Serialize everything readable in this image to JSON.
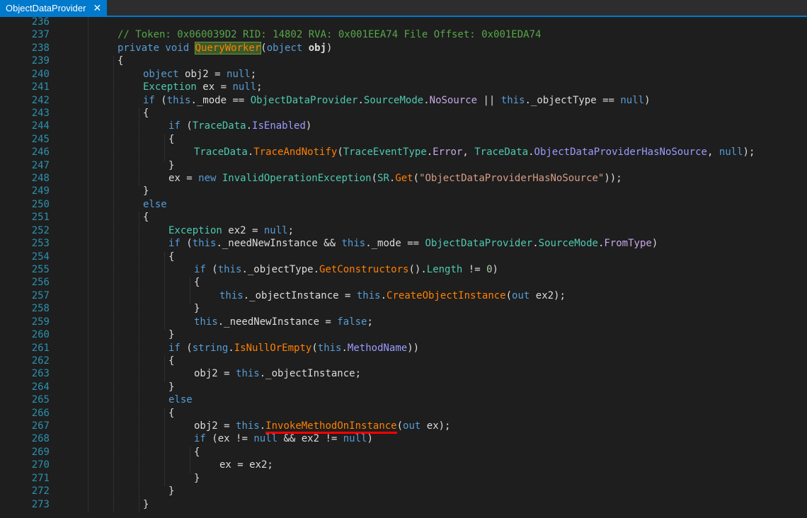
{
  "tab": {
    "title": "ObjectDataProvider",
    "close": "✕"
  },
  "lines": [
    {
      "n": "236",
      "segs": []
    },
    {
      "n": "237",
      "segs": [
        {
          "t": "// Token: 0x060039D2 RID: 14802 RVA: 0x001EEA74 File Offset: 0x001EDA74",
          "c": "c"
        }
      ],
      "ind": 1
    },
    {
      "n": "238",
      "segs": [
        {
          "t": "private void ",
          "c": "k"
        },
        {
          "t": "QueryWorker",
          "c": "hl"
        },
        {
          "t": "(",
          "c": ""
        },
        {
          "t": "object ",
          "c": "k"
        },
        {
          "t": "obj",
          "c": "bold"
        },
        {
          "t": ")",
          "c": ""
        }
      ],
      "ind": 1
    },
    {
      "n": "239",
      "segs": [
        {
          "t": "{",
          "c": ""
        }
      ],
      "ind": 1
    },
    {
      "n": "240",
      "segs": [
        {
          "t": "object ",
          "c": "k"
        },
        {
          "t": "obj2 = ",
          "c": ""
        },
        {
          "t": "null",
          "c": "k"
        },
        {
          "t": ";",
          "c": ""
        }
      ],
      "ind": 2
    },
    {
      "n": "241",
      "segs": [
        {
          "t": "Exception ",
          "c": "t"
        },
        {
          "t": "ex = ",
          "c": ""
        },
        {
          "t": "null",
          "c": "k"
        },
        {
          "t": ";",
          "c": ""
        }
      ],
      "ind": 2
    },
    {
      "n": "242",
      "segs": [
        {
          "t": "if ",
          "c": "k"
        },
        {
          "t": "(",
          "c": ""
        },
        {
          "t": "this",
          "c": "k"
        },
        {
          "t": "._mode == ",
          "c": ""
        },
        {
          "t": "ObjectDataProvider",
          "c": "t"
        },
        {
          "t": ".",
          "c": ""
        },
        {
          "t": "SourceMode",
          "c": "t"
        },
        {
          "t": ".",
          "c": ""
        },
        {
          "t": "NoSource",
          "c": "p"
        },
        {
          "t": " || ",
          "c": ""
        },
        {
          "t": "this",
          "c": "k"
        },
        {
          "t": "._objectType == ",
          "c": ""
        },
        {
          "t": "null",
          "c": "k"
        },
        {
          "t": ")",
          "c": ""
        }
      ],
      "ind": 2
    },
    {
      "n": "243",
      "segs": [
        {
          "t": "{",
          "c": ""
        }
      ],
      "ind": 2
    },
    {
      "n": "244",
      "segs": [
        {
          "t": "if ",
          "c": "k"
        },
        {
          "t": "(",
          "c": ""
        },
        {
          "t": "TraceData",
          "c": "t"
        },
        {
          "t": ".",
          "c": ""
        },
        {
          "t": "IsEnabled",
          "c": "prop"
        },
        {
          "t": ")",
          "c": ""
        }
      ],
      "ind": 3
    },
    {
      "n": "245",
      "segs": [
        {
          "t": "{",
          "c": ""
        }
      ],
      "ind": 3
    },
    {
      "n": "246",
      "segs": [
        {
          "t": "TraceData",
          "c": "t"
        },
        {
          "t": ".",
          "c": ""
        },
        {
          "t": "TraceAndNotify",
          "c": "f"
        },
        {
          "t": "(",
          "c": ""
        },
        {
          "t": "TraceEventType",
          "c": "t"
        },
        {
          "t": ".",
          "c": ""
        },
        {
          "t": "Error",
          "c": "p"
        },
        {
          "t": ", ",
          "c": ""
        },
        {
          "t": "TraceData",
          "c": "t"
        },
        {
          "t": ".",
          "c": ""
        },
        {
          "t": "ObjectDataProviderHasNoSource",
          "c": "prop"
        },
        {
          "t": ", ",
          "c": ""
        },
        {
          "t": "null",
          "c": "k"
        },
        {
          "t": ");",
          "c": ""
        }
      ],
      "ind": 4
    },
    {
      "n": "247",
      "segs": [
        {
          "t": "}",
          "c": ""
        }
      ],
      "ind": 3
    },
    {
      "n": "248",
      "segs": [
        {
          "t": "ex = ",
          "c": ""
        },
        {
          "t": "new ",
          "c": "k"
        },
        {
          "t": "InvalidOperationException",
          "c": "t"
        },
        {
          "t": "(",
          "c": ""
        },
        {
          "t": "SR",
          "c": "t"
        },
        {
          "t": ".",
          "c": ""
        },
        {
          "t": "Get",
          "c": "f"
        },
        {
          "t": "(",
          "c": ""
        },
        {
          "t": "\"ObjectDataProviderHasNoSource\"",
          "c": "s"
        },
        {
          "t": "));",
          "c": ""
        }
      ],
      "ind": 3
    },
    {
      "n": "249",
      "segs": [
        {
          "t": "}",
          "c": ""
        }
      ],
      "ind": 2
    },
    {
      "n": "250",
      "segs": [
        {
          "t": "else",
          "c": "k"
        }
      ],
      "ind": 2
    },
    {
      "n": "251",
      "segs": [
        {
          "t": "{",
          "c": ""
        }
      ],
      "ind": 2
    },
    {
      "n": "252",
      "segs": [
        {
          "t": "Exception ",
          "c": "t"
        },
        {
          "t": "ex2 = ",
          "c": ""
        },
        {
          "t": "null",
          "c": "k"
        },
        {
          "t": ";",
          "c": ""
        }
      ],
      "ind": 3
    },
    {
      "n": "253",
      "segs": [
        {
          "t": "if ",
          "c": "k"
        },
        {
          "t": "(",
          "c": ""
        },
        {
          "t": "this",
          "c": "k"
        },
        {
          "t": "._needNewInstance && ",
          "c": ""
        },
        {
          "t": "this",
          "c": "k"
        },
        {
          "t": "._mode == ",
          "c": ""
        },
        {
          "t": "ObjectDataProvider",
          "c": "t"
        },
        {
          "t": ".",
          "c": ""
        },
        {
          "t": "SourceMode",
          "c": "t"
        },
        {
          "t": ".",
          "c": ""
        },
        {
          "t": "FromType",
          "c": "p"
        },
        {
          "t": ")",
          "c": ""
        }
      ],
      "ind": 3
    },
    {
      "n": "254",
      "segs": [
        {
          "t": "{",
          "c": ""
        }
      ],
      "ind": 3
    },
    {
      "n": "255",
      "segs": [
        {
          "t": "if ",
          "c": "k"
        },
        {
          "t": "(",
          "c": ""
        },
        {
          "t": "this",
          "c": "k"
        },
        {
          "t": "._objectType.",
          "c": ""
        },
        {
          "t": "GetConstructors",
          "c": "f"
        },
        {
          "t": "().",
          "c": ""
        },
        {
          "t": "Length",
          "c": "t"
        },
        {
          "t": " != ",
          "c": ""
        },
        {
          "t": "0",
          "c": "n"
        },
        {
          "t": ")",
          "c": ""
        }
      ],
      "ind": 4
    },
    {
      "n": "256",
      "segs": [
        {
          "t": "{",
          "c": ""
        }
      ],
      "ind": 4
    },
    {
      "n": "257",
      "segs": [
        {
          "t": "this",
          "c": "k"
        },
        {
          "t": "._objectInstance = ",
          "c": ""
        },
        {
          "t": "this",
          "c": "k"
        },
        {
          "t": ".",
          "c": ""
        },
        {
          "t": "CreateObjectInstance",
          "c": "f"
        },
        {
          "t": "(",
          "c": ""
        },
        {
          "t": "out ",
          "c": "k"
        },
        {
          "t": "ex2);",
          "c": ""
        }
      ],
      "ind": 5
    },
    {
      "n": "258",
      "segs": [
        {
          "t": "}",
          "c": ""
        }
      ],
      "ind": 4
    },
    {
      "n": "259",
      "segs": [
        {
          "t": "this",
          "c": "k"
        },
        {
          "t": "._needNewInstance = ",
          "c": ""
        },
        {
          "t": "false",
          "c": "k"
        },
        {
          "t": ";",
          "c": ""
        }
      ],
      "ind": 4
    },
    {
      "n": "260",
      "segs": [
        {
          "t": "}",
          "c": ""
        }
      ],
      "ind": 3
    },
    {
      "n": "261",
      "segs": [
        {
          "t": "if ",
          "c": "k"
        },
        {
          "t": "(",
          "c": ""
        },
        {
          "t": "string",
          "c": "k"
        },
        {
          "t": ".",
          "c": ""
        },
        {
          "t": "IsNullOrEmpty",
          "c": "f"
        },
        {
          "t": "(",
          "c": ""
        },
        {
          "t": "this",
          "c": "k"
        },
        {
          "t": ".",
          "c": ""
        },
        {
          "t": "MethodName",
          "c": "prop"
        },
        {
          "t": "))",
          "c": ""
        }
      ],
      "ind": 3
    },
    {
      "n": "262",
      "segs": [
        {
          "t": "{",
          "c": ""
        }
      ],
      "ind": 3
    },
    {
      "n": "263",
      "segs": [
        {
          "t": "obj2 = ",
          "c": ""
        },
        {
          "t": "this",
          "c": "k"
        },
        {
          "t": "._objectInstance;",
          "c": ""
        }
      ],
      "ind": 4
    },
    {
      "n": "264",
      "segs": [
        {
          "t": "}",
          "c": ""
        }
      ],
      "ind": 3
    },
    {
      "n": "265",
      "segs": [
        {
          "t": "else",
          "c": "k"
        }
      ],
      "ind": 3
    },
    {
      "n": "266",
      "segs": [
        {
          "t": "{",
          "c": ""
        }
      ],
      "ind": 3
    },
    {
      "n": "267",
      "segs": [
        {
          "t": "obj2 = ",
          "c": ""
        },
        {
          "t": "this",
          "c": "k"
        },
        {
          "t": ".",
          "c": ""
        },
        {
          "t": "InvokeMethodOnInstance",
          "c": "f underline-red"
        },
        {
          "t": "(",
          "c": ""
        },
        {
          "t": "out ",
          "c": "k"
        },
        {
          "t": "ex);",
          "c": ""
        }
      ],
      "ind": 4
    },
    {
      "n": "268",
      "segs": [
        {
          "t": "if ",
          "c": "k"
        },
        {
          "t": "(ex != ",
          "c": ""
        },
        {
          "t": "null",
          "c": "k"
        },
        {
          "t": " && ex2 != ",
          "c": ""
        },
        {
          "t": "null",
          "c": "k"
        },
        {
          "t": ")",
          "c": ""
        }
      ],
      "ind": 4
    },
    {
      "n": "269",
      "segs": [
        {
          "t": "{",
          "c": ""
        }
      ],
      "ind": 4
    },
    {
      "n": "270",
      "segs": [
        {
          "t": "ex = ex2;",
          "c": ""
        }
      ],
      "ind": 5
    },
    {
      "n": "271",
      "segs": [
        {
          "t": "}",
          "c": ""
        }
      ],
      "ind": 4
    },
    {
      "n": "272",
      "segs": [
        {
          "t": "}",
          "c": ""
        }
      ],
      "ind": 3
    },
    {
      "n": "273",
      "segs": [
        {
          "t": "}",
          "c": ""
        }
      ],
      "ind": 2
    }
  ],
  "colors": {
    "background": "#1e1e1e",
    "tab_active": "#007acc",
    "line_number": "#2b91af",
    "keyword": "#569cd6",
    "type": "#4ec9b0",
    "method": "#ff8000",
    "comment": "#57a64a",
    "string": "#d69d85",
    "underline": "#ff0000"
  }
}
